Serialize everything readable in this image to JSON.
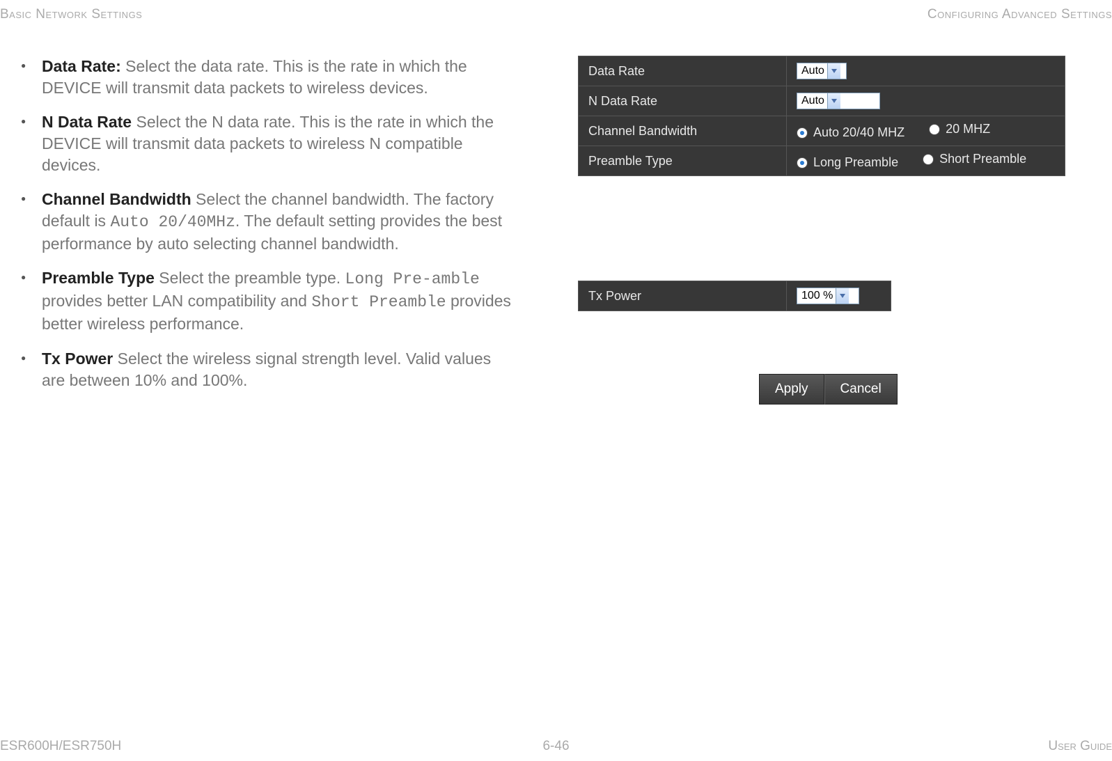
{
  "header": {
    "left": "Basic Network Settings",
    "right": "Configuring Advanced Settings"
  },
  "footer": {
    "left": "ESR600H/ESR750H",
    "center": "6-46",
    "right": "User Guide"
  },
  "bullets": [
    {
      "bold": "Data Rate:",
      "text_a": " Select the data rate.  This is the rate in which the DEVICE will transmit data packets to wireless devices."
    },
    {
      "bold": "N Data Rate",
      "text_a": "  Select the N data rate. This is the rate in which the DEVICE will transmit data packets to wireless N compatible devices."
    },
    {
      "bold": "Channel Bandwidth",
      "text_a": "  Select the channel bandwidth. The factory default is ",
      "mono_a": "Auto 20/40MHz",
      "text_b": ". The default setting provides the best performance by auto selecting channel bandwidth."
    },
    {
      "bold": "Preamble Type",
      "text_a": "  Select the preamble type. ",
      "mono_a": "Long Pre-amble",
      "text_b": " provides better LAN compatibility and ",
      "mono_b": "Short Preamble",
      "text_c": " provides better wireless performance."
    },
    {
      "bold": "Tx Power",
      "text_a": "  Select the wireless signal strength level. Valid values are between 10% and 100%."
    }
  ],
  "panel1": {
    "rows": {
      "data_rate": {
        "label": "Data Rate",
        "value": "Auto"
      },
      "n_data_rate": {
        "label": "N Data Rate",
        "value": "Auto"
      },
      "ch_bw": {
        "label": "Channel Bandwidth",
        "opt1": "Auto 20/40 MHZ",
        "opt2": "20 MHZ"
      },
      "preamble": {
        "label": "Preamble Type",
        "opt1": "Long Preamble",
        "opt2": "Short Preamble"
      }
    }
  },
  "panel2": {
    "row": {
      "label": "Tx Power",
      "value": "100 %"
    }
  },
  "buttons": {
    "apply": "Apply",
    "cancel": "Cancel"
  }
}
